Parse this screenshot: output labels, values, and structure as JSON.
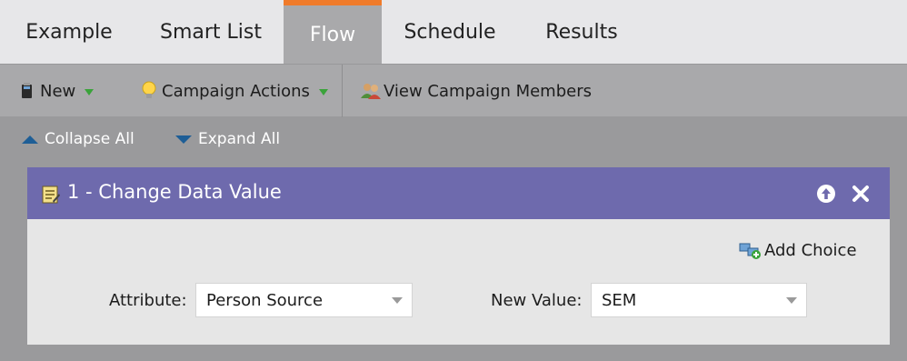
{
  "tabs": [
    {
      "label": "Example"
    },
    {
      "label": "Smart List"
    },
    {
      "label": "Flow"
    },
    {
      "label": "Schedule"
    },
    {
      "label": "Results"
    }
  ],
  "active_tab": "Flow",
  "toolbar": {
    "new_label": "New",
    "actions_label": "Campaign Actions",
    "members_label": "View Campaign Members"
  },
  "controls": {
    "collapse_label": "Collapse All",
    "expand_label": "Expand All"
  },
  "step": {
    "title": "1 - Change Data Value",
    "add_choice_label": "Add Choice",
    "attribute_label": "Attribute:",
    "attribute_value": "Person Source",
    "new_value_label": "New Value:",
    "new_value_value": "SEM"
  },
  "colors": {
    "active_tab_border": "#f07b2a",
    "step_header": "#6e6aad",
    "toolbar": "#a9a9ab",
    "background": "#9a9a9c"
  }
}
